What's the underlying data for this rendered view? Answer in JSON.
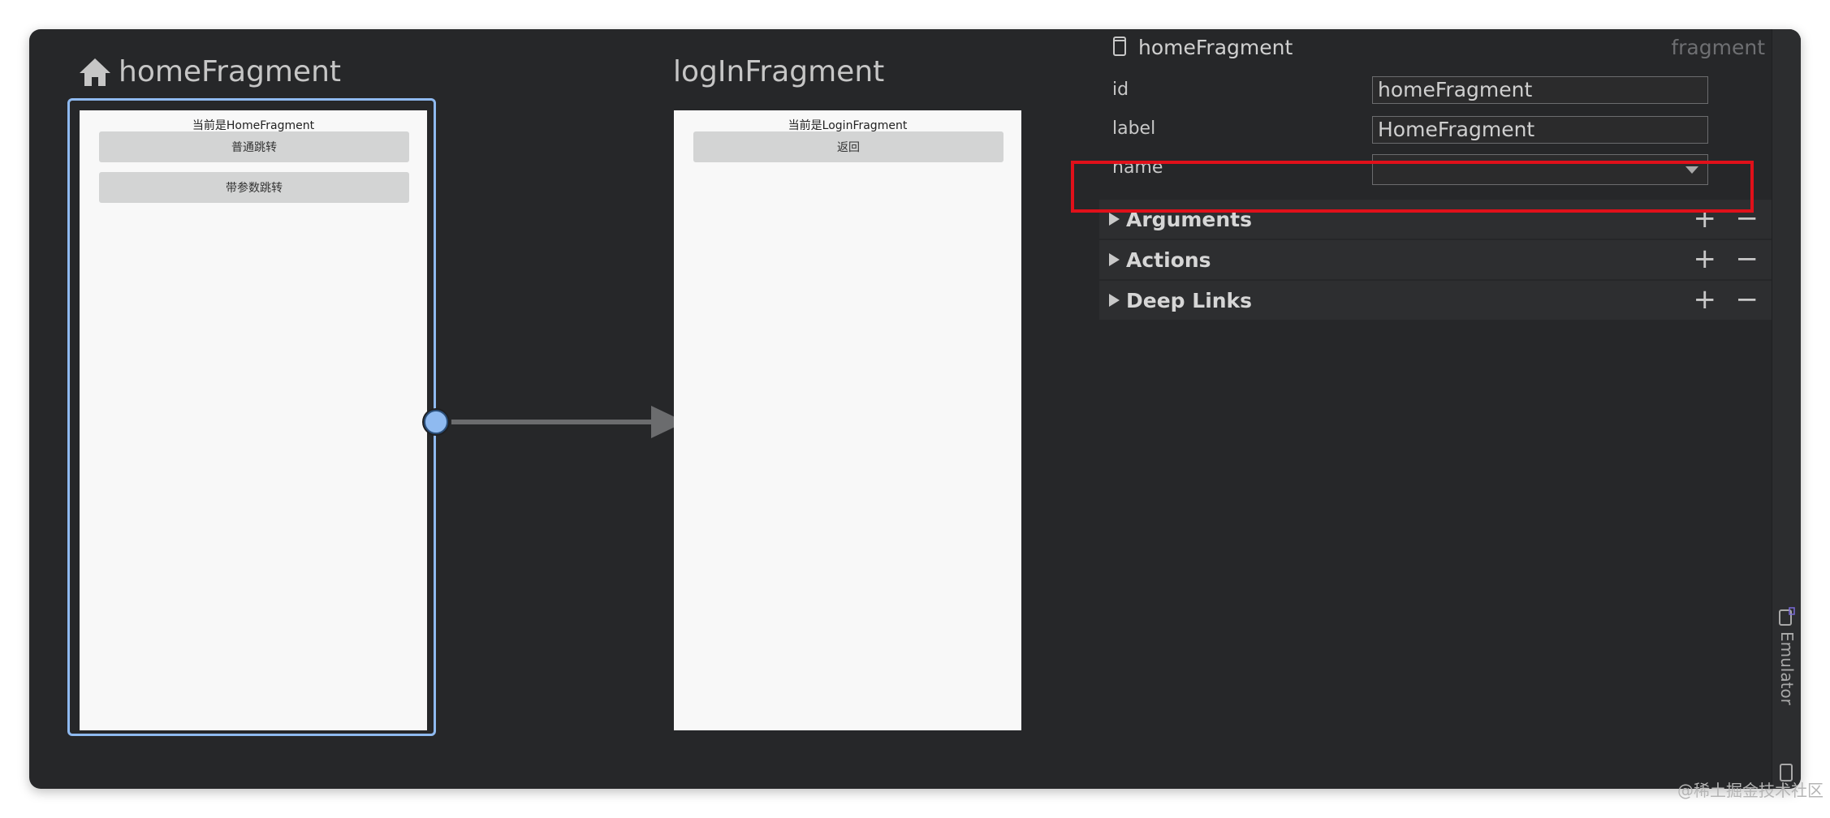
{
  "canvas": {
    "home_title": "homeFragment",
    "home_screen_text": "当前是HomeFragment",
    "home_buttons": [
      "普通跳转",
      "带参数跳转"
    ],
    "login_title": "logInFragment",
    "login_screen_text": "当前是LoginFragment",
    "login_buttons": [
      "返回"
    ]
  },
  "panel": {
    "name": "homeFragment",
    "type": "fragment",
    "props": {
      "id_label": "id",
      "id_value": "homeFragment",
      "label_label": "label",
      "label_value": "HomeFragment",
      "name_label": "name",
      "name_value": ""
    },
    "sections": [
      {
        "label": "Arguments",
        "plus": "+",
        "minus": "−"
      },
      {
        "label": "Actions",
        "plus": "+",
        "minus": "−"
      },
      {
        "label": "Deep Links",
        "plus": "+",
        "minus": "−"
      }
    ]
  },
  "strip": {
    "emulator_label": "Emulator"
  },
  "watermark": "@稀土掘金技术社区",
  "colors": {
    "background": "#262729",
    "selection": "#8fbaf0",
    "highlight": "#e0101a",
    "screen": "#f8f8f8"
  }
}
